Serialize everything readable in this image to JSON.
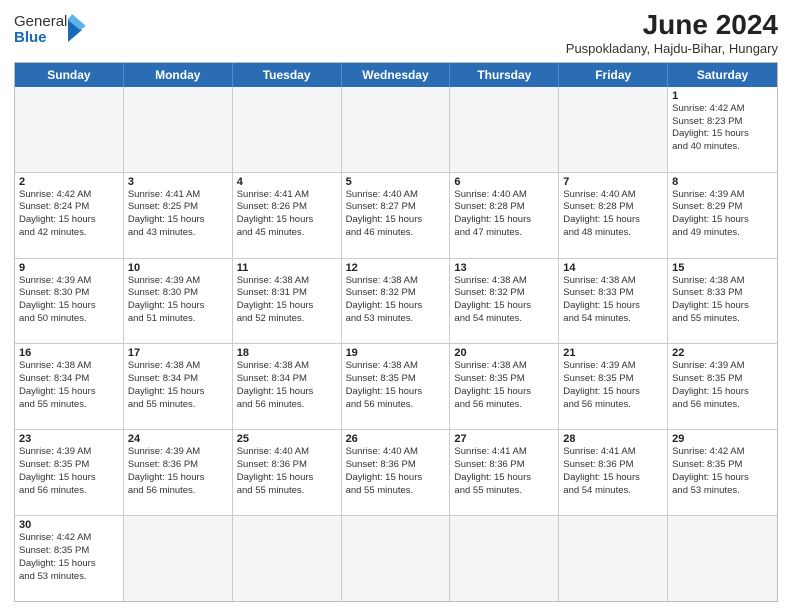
{
  "header": {
    "logo_general": "General",
    "logo_blue": "Blue",
    "title": "June 2024",
    "subtitle": "Puspokladany, Hajdu-Bihar, Hungary"
  },
  "days_of_week": [
    "Sunday",
    "Monday",
    "Tuesday",
    "Wednesday",
    "Thursday",
    "Friday",
    "Saturday"
  ],
  "weeks": [
    [
      {
        "day": "",
        "empty": true
      },
      {
        "day": "",
        "empty": true
      },
      {
        "day": "",
        "empty": true
      },
      {
        "day": "",
        "empty": true
      },
      {
        "day": "",
        "empty": true
      },
      {
        "day": "",
        "empty": true
      },
      {
        "day": "1",
        "info": "Sunrise: 4:42 AM\nSunset: 8:23 PM\nDaylight: 15 hours\nand 40 minutes."
      }
    ],
    [
      {
        "day": "2",
        "info": "Sunrise: 4:42 AM\nSunset: 8:24 PM\nDaylight: 15 hours\nand 42 minutes."
      },
      {
        "day": "3",
        "info": "Sunrise: 4:41 AM\nSunset: 8:25 PM\nDaylight: 15 hours\nand 43 minutes."
      },
      {
        "day": "4",
        "info": "Sunrise: 4:41 AM\nSunset: 8:26 PM\nDaylight: 15 hours\nand 45 minutes."
      },
      {
        "day": "5",
        "info": "Sunrise: 4:40 AM\nSunset: 8:27 PM\nDaylight: 15 hours\nand 46 minutes."
      },
      {
        "day": "6",
        "info": "Sunrise: 4:40 AM\nSunset: 8:28 PM\nDaylight: 15 hours\nand 47 minutes."
      },
      {
        "day": "7",
        "info": "Sunrise: 4:40 AM\nSunset: 8:28 PM\nDaylight: 15 hours\nand 48 minutes."
      },
      {
        "day": "8",
        "info": "Sunrise: 4:39 AM\nSunset: 8:29 PM\nDaylight: 15 hours\nand 49 minutes."
      }
    ],
    [
      {
        "day": "9",
        "info": "Sunrise: 4:39 AM\nSunset: 8:30 PM\nDaylight: 15 hours\nand 50 minutes."
      },
      {
        "day": "10",
        "info": "Sunrise: 4:39 AM\nSunset: 8:30 PM\nDaylight: 15 hours\nand 51 minutes."
      },
      {
        "day": "11",
        "info": "Sunrise: 4:38 AM\nSunset: 8:31 PM\nDaylight: 15 hours\nand 52 minutes."
      },
      {
        "day": "12",
        "info": "Sunrise: 4:38 AM\nSunset: 8:32 PM\nDaylight: 15 hours\nand 53 minutes."
      },
      {
        "day": "13",
        "info": "Sunrise: 4:38 AM\nSunset: 8:32 PM\nDaylight: 15 hours\nand 54 minutes."
      },
      {
        "day": "14",
        "info": "Sunrise: 4:38 AM\nSunset: 8:33 PM\nDaylight: 15 hours\nand 54 minutes."
      },
      {
        "day": "15",
        "info": "Sunrise: 4:38 AM\nSunset: 8:33 PM\nDaylight: 15 hours\nand 55 minutes."
      }
    ],
    [
      {
        "day": "16",
        "info": "Sunrise: 4:38 AM\nSunset: 8:34 PM\nDaylight: 15 hours\nand 55 minutes."
      },
      {
        "day": "17",
        "info": "Sunrise: 4:38 AM\nSunset: 8:34 PM\nDaylight: 15 hours\nand 55 minutes."
      },
      {
        "day": "18",
        "info": "Sunrise: 4:38 AM\nSunset: 8:34 PM\nDaylight: 15 hours\nand 56 minutes."
      },
      {
        "day": "19",
        "info": "Sunrise: 4:38 AM\nSunset: 8:35 PM\nDaylight: 15 hours\nand 56 minutes."
      },
      {
        "day": "20",
        "info": "Sunrise: 4:38 AM\nSunset: 8:35 PM\nDaylight: 15 hours\nand 56 minutes."
      },
      {
        "day": "21",
        "info": "Sunrise: 4:39 AM\nSunset: 8:35 PM\nDaylight: 15 hours\nand 56 minutes."
      },
      {
        "day": "22",
        "info": "Sunrise: 4:39 AM\nSunset: 8:35 PM\nDaylight: 15 hours\nand 56 minutes."
      }
    ],
    [
      {
        "day": "23",
        "info": "Sunrise: 4:39 AM\nSunset: 8:35 PM\nDaylight: 15 hours\nand 56 minutes."
      },
      {
        "day": "24",
        "info": "Sunrise: 4:39 AM\nSunset: 8:36 PM\nDaylight: 15 hours\nand 56 minutes."
      },
      {
        "day": "25",
        "info": "Sunrise: 4:40 AM\nSunset: 8:36 PM\nDaylight: 15 hours\nand 55 minutes."
      },
      {
        "day": "26",
        "info": "Sunrise: 4:40 AM\nSunset: 8:36 PM\nDaylight: 15 hours\nand 55 minutes."
      },
      {
        "day": "27",
        "info": "Sunrise: 4:41 AM\nSunset: 8:36 PM\nDaylight: 15 hours\nand 55 minutes."
      },
      {
        "day": "28",
        "info": "Sunrise: 4:41 AM\nSunset: 8:36 PM\nDaylight: 15 hours\nand 54 minutes."
      },
      {
        "day": "29",
        "info": "Sunrise: 4:42 AM\nSunset: 8:35 PM\nDaylight: 15 hours\nand 53 minutes."
      }
    ],
    [
      {
        "day": "30",
        "info": "Sunrise: 4:42 AM\nSunset: 8:35 PM\nDaylight: 15 hours\nand 53 minutes."
      },
      {
        "day": "",
        "empty": true
      },
      {
        "day": "",
        "empty": true
      },
      {
        "day": "",
        "empty": true
      },
      {
        "day": "",
        "empty": true
      },
      {
        "day": "",
        "empty": true
      },
      {
        "day": "",
        "empty": true
      }
    ]
  ]
}
